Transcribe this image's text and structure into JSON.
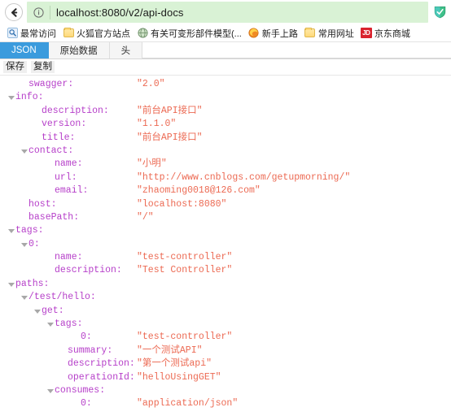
{
  "browser": {
    "back_button_label": "Back",
    "identity_icon": "info-circle-icon",
    "url": "localhost:8080/v2/api-docs",
    "url_host": "localhost:8080",
    "url_path": "/v2/api-docs",
    "shield_icon": "green-shield-icon",
    "url_bar_bg": "#d9f2d5"
  },
  "bookmarks": [
    {
      "label": "最常访问",
      "icon": "most-visited-icon"
    },
    {
      "label": "火狐官方站点",
      "icon": "folder-icon"
    },
    {
      "label": "有关可变形部件模型(...",
      "icon": "globe-icon"
    },
    {
      "label": "新手上路",
      "icon": "firefox-icon"
    },
    {
      "label": "常用网址",
      "icon": "folder-icon"
    },
    {
      "label": "京东商城",
      "icon": "jd-icon"
    }
  ],
  "viewer": {
    "tabs": [
      {
        "label": "JSON",
        "active": true
      },
      {
        "label": "原始数据",
        "active": false
      },
      {
        "label": "头",
        "active": false
      }
    ],
    "actions": [
      {
        "label": "保存"
      },
      {
        "label": "复制"
      }
    ],
    "active_tab_color": "#3b9bdd",
    "key_color": "#b63fc9",
    "value_color": "#ec6a53"
  },
  "json_rows": [
    {
      "indent": 1,
      "twisty": false,
      "key": "swagger",
      "value": "\"2.0\""
    },
    {
      "indent": 0,
      "twisty": true,
      "key": "info",
      "value": ""
    },
    {
      "indent": 2,
      "twisty": false,
      "key": "description",
      "value": "\"前台API接口\""
    },
    {
      "indent": 2,
      "twisty": false,
      "key": "version",
      "value": "\"1.1.0\""
    },
    {
      "indent": 2,
      "twisty": false,
      "key": "title",
      "value": "\"前台API接口\""
    },
    {
      "indent": 1,
      "twisty": true,
      "key": "contact",
      "value": ""
    },
    {
      "indent": 3,
      "twisty": false,
      "key": "name",
      "value": "\"小明\""
    },
    {
      "indent": 3,
      "twisty": false,
      "key": "url",
      "value": "\"http://www.cnblogs.com/getupmorning/\""
    },
    {
      "indent": 3,
      "twisty": false,
      "key": "email",
      "value": "\"zhaoming0018@126.com\""
    },
    {
      "indent": 1,
      "twisty": false,
      "key": "host",
      "value": "\"localhost:8080\""
    },
    {
      "indent": 1,
      "twisty": false,
      "key": "basePath",
      "value": "\"/\""
    },
    {
      "indent": 0,
      "twisty": true,
      "key": "tags",
      "value": ""
    },
    {
      "indent": 1,
      "twisty": true,
      "key": "0",
      "value": ""
    },
    {
      "indent": 3,
      "twisty": false,
      "key": "name",
      "value": "\"test-controller\""
    },
    {
      "indent": 3,
      "twisty": false,
      "key": "description",
      "value": "\"Test Controller\""
    },
    {
      "indent": 0,
      "twisty": true,
      "key": "paths",
      "value": ""
    },
    {
      "indent": 1,
      "twisty": true,
      "key": "/test/hello",
      "value": ""
    },
    {
      "indent": 2,
      "twisty": true,
      "key": "get",
      "value": ""
    },
    {
      "indent": 3,
      "twisty": true,
      "key": "tags",
      "value": ""
    },
    {
      "indent": 5,
      "twisty": false,
      "key": "0",
      "value": "\"test-controller\""
    },
    {
      "indent": 4,
      "twisty": false,
      "key": "summary",
      "value": "\"一个测试API\""
    },
    {
      "indent": 4,
      "twisty": false,
      "key": "description",
      "value": "\"第一个测试api\""
    },
    {
      "indent": 4,
      "twisty": false,
      "key": "operationId",
      "value": "\"helloUsingGET\""
    },
    {
      "indent": 3,
      "twisty": true,
      "key": "consumes",
      "value": ""
    },
    {
      "indent": 5,
      "twisty": false,
      "key": "0",
      "value": "\"application/json\""
    }
  ]
}
